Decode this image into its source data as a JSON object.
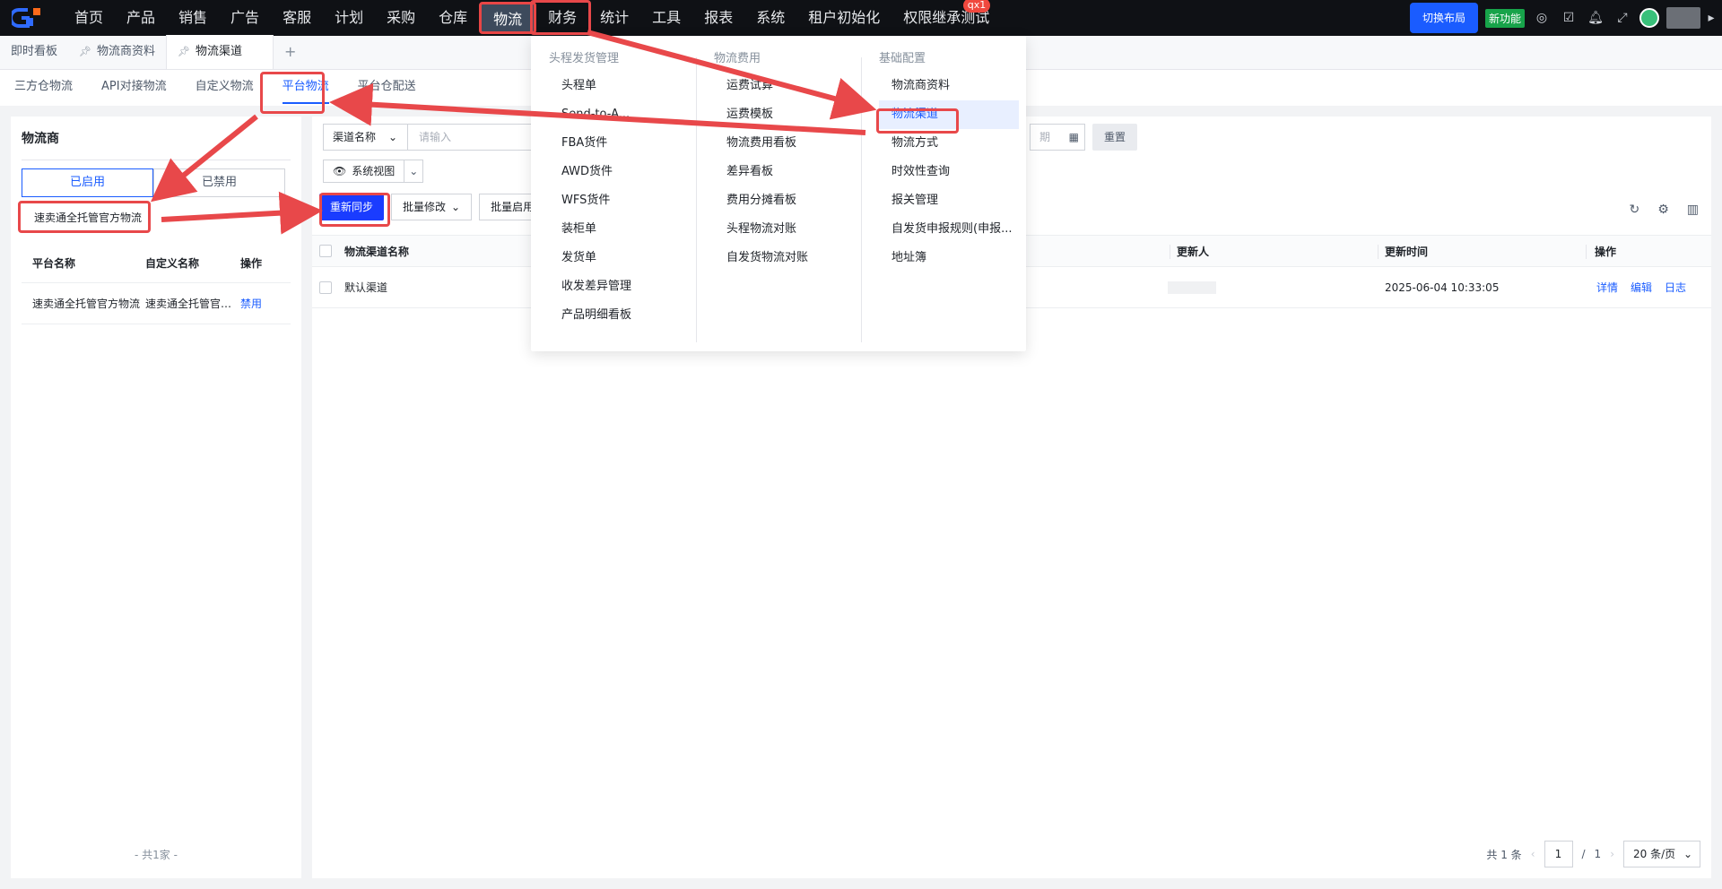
{
  "topnav": {
    "items": [
      "首页",
      "产品",
      "销售",
      "广告",
      "客服",
      "计划",
      "采购",
      "仓库",
      "物流",
      "财务",
      "统计",
      "工具",
      "报表",
      "系统",
      "租户初始化",
      "权限继承测试"
    ],
    "active_index": 8,
    "badge": "qx1",
    "switch_layout": "切换布局",
    "new_feature": "新功能"
  },
  "page_tabs": [
    {
      "label": "即时看板"
    },
    {
      "label": "物流商资料"
    },
    {
      "label": "物流渠道",
      "active": true
    },
    {
      "label": "+"
    }
  ],
  "sub_tabs": [
    "三方仓物流",
    "API对接物流",
    "自定义物流",
    "平台物流",
    "平台仓配送"
  ],
  "sub_tab_active": 3,
  "left": {
    "title": "物流商",
    "seg_enabled": "已启用",
    "seg_disabled": "已禁用",
    "selected": "速卖通全托管官方物流",
    "columns": [
      "平台名称",
      "自定义名称",
      "操作"
    ],
    "rows": [
      {
        "platform": "速卖通全托管官方物流",
        "custom": "速卖通全托管官方物流",
        "action": "禁用"
      }
    ],
    "footer": "- 共1家 -"
  },
  "right": {
    "filter_field": "渠道名称",
    "filter_placeholder": "请输入",
    "date_placeholder": "期",
    "reset": "重置",
    "view_label": "系统视图",
    "btn_resync": "重新同步",
    "btn_batch_edit": "批量修改",
    "btn_batch_enable": "批量启用",
    "columns": {
      "name": "物流渠道名称",
      "updater": "更新人",
      "updated_at": "更新时间",
      "ops": "操作"
    },
    "rows": [
      {
        "name": "默认渠道",
        "updated_at": "2025-06-04 10:33:05",
        "ops": [
          "详情",
          "编辑",
          "日志"
        ]
      }
    ],
    "pager": {
      "total": "共 1 条",
      "page": "1",
      "sep": "/",
      "pages": "1",
      "size": "20 条/页"
    }
  },
  "menu": {
    "col1": {
      "head": "头程发货管理",
      "items": [
        "头程单",
        "Send-to-A...",
        "FBA货件",
        "AWD货件",
        "WFS货件",
        "装柜单",
        "发货单",
        "收发差异管理",
        "产品明细看板"
      ]
    },
    "col2": {
      "head": "物流费用",
      "items": [
        "运费试算",
        "运费模板",
        "物流费用看板",
        "差异看板",
        "费用分摊看板",
        "头程物流对账",
        "自发货物流对账"
      ]
    },
    "col3": {
      "head": "基础配置",
      "items": [
        "物流商资料",
        "物流渠道",
        "物流方式",
        "时效性查询",
        "报关管理",
        "自发货申报规则(申报...",
        "地址簿"
      ],
      "current_index": 1
    }
  },
  "colors": {
    "accent": "#1a5cff",
    "annotation": "#e8484a",
    "topbar": "#0f1115"
  }
}
